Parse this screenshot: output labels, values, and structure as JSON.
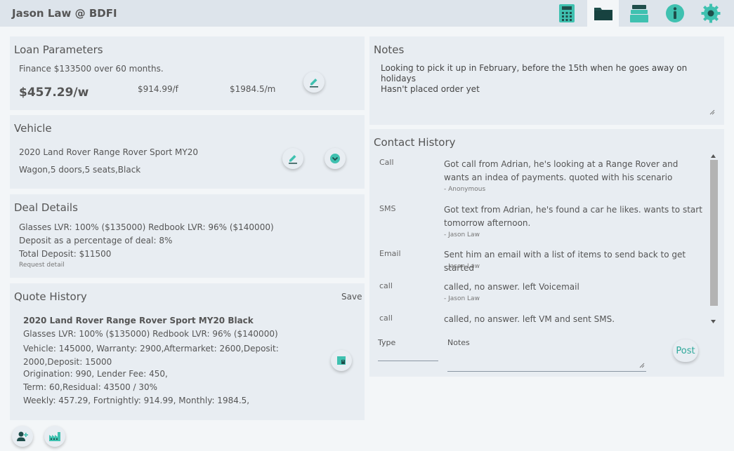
{
  "app": {
    "title": "Jason Law @ BDFI"
  },
  "toolbar": {
    "icons": [
      "calculator-icon",
      "folder-icon",
      "stack-icon",
      "info-icon",
      "settings-icon"
    ]
  },
  "loan": {
    "title": "Loan Parameters",
    "summary": "Finance $133500 over 60 months.",
    "weekly": "$457.29/w",
    "fortnightly": "$914.99/f",
    "monthly": "$1984.5/m"
  },
  "vehicle": {
    "title": "Vehicle",
    "name": "2020 Land Rover Range Rover Sport MY20",
    "details": "Wagon,5 doors,5 seats,Black"
  },
  "deal": {
    "title": "Deal Details",
    "lines": [
      "Glasses LVR: 100% ($135000) Redbook LVR: 96% ($140000)",
      "Deposit as a percentage of deal: 8%",
      "Total Deposit: $11500"
    ],
    "request_link": "Request detail"
  },
  "quote": {
    "title": "Quote History",
    "save": "Save",
    "heading": "2020 Land Rover Range Rover Sport MY20 Black",
    "lines": [
      "Glasses LVR: 100% ($135000) Redbook LVR: 96% ($140000)",
      "Vehicle: 145000, Warranty: 2900,Aftermarket: 2600,Deposit: 2000,Deposit: 15000",
      "Origination: 990, Lender Fee: 450,",
      "Term: 60,Residual: 43500 / 30%",
      "Weekly: 457.29, Fortnightly: 914.99, Monthly: 1984.5,"
    ]
  },
  "notes": {
    "title": "Notes",
    "line1": "Looking to pick it up in February, before the 15th when he goes away on holidays",
    "line2": "Hasn't placed order yet"
  },
  "contact": {
    "title": "Contact History",
    "items": [
      {
        "type": "Call",
        "message": "Got call from Adrian, he's looking at a Range Rover and wants an indea of payments. quoted with his scenario",
        "by": "- Anonymous"
      },
      {
        "type": "SMS",
        "message": "Got text from Adrian, he's found a car he likes. wants to start tomorrow afternoon.",
        "by": "- Jason Law"
      },
      {
        "type": "Email",
        "message": "Sent him an email with a list of items to send back to get started",
        "by": "- Jason Law"
      },
      {
        "type": "call",
        "message": "called, no answer. left Voicemail",
        "by": "- Jason Law"
      },
      {
        "type": "call",
        "message": "called, no answer. left VM and sent SMS.",
        "by": ""
      }
    ],
    "type_label": "Type",
    "notes_label": "Notes",
    "post": "Post"
  },
  "colors": {
    "accent": "#3fc1b0",
    "dark": "#1f4e4b",
    "panel": "#e8edf2"
  }
}
